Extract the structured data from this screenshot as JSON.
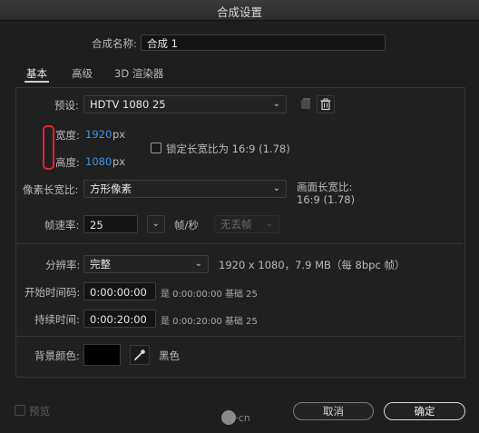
{
  "window": {
    "title": "合成设置"
  },
  "comp_name": {
    "label": "合成名称:",
    "value": "合成 1"
  },
  "tabs": [
    {
      "label": "基本"
    },
    {
      "label": "高级"
    },
    {
      "label": "3D 渲染器"
    }
  ],
  "preset": {
    "label": "预设:",
    "value": "HDTV 1080 25"
  },
  "width": {
    "label": "宽度:",
    "value": "1920",
    "unit": "px"
  },
  "height": {
    "label": "高度:",
    "value": "1080",
    "unit": "px"
  },
  "lock_aspect": {
    "label": "锁定长宽比为 16:9 (1.78)",
    "checked": false
  },
  "pixel_aspect": {
    "label": "像素长宽比:",
    "value": "方形像素"
  },
  "frame_aspect": {
    "label": "画面长宽比:",
    "value": "16:9 (1.78)"
  },
  "frame_rate": {
    "label": "帧速率:",
    "value": "25",
    "unit": "帧/秒",
    "dropframe": "无丢帧"
  },
  "resolution": {
    "label": "分辨率:",
    "value": "完整",
    "info": "1920 x 1080，7.9 MB（每 8bpc 帧）"
  },
  "start_timecode": {
    "label": "开始时间码:",
    "value": "0:00:00:00",
    "note": "是 0:00:00:00  基础 25"
  },
  "duration": {
    "label": "持续时间:",
    "value": "0:00:20:00",
    "note": "是 0:00:20:00  基础 25"
  },
  "background": {
    "label": "背景颜色:",
    "color": "#000000",
    "color_name": "黑色"
  },
  "footer": {
    "preview_label": "预览",
    "cancel_label": "取消",
    "ok_label": "确定",
    "watermark": "UI·cn"
  },
  "colors": {
    "accent_blue": "#3f95e6",
    "highlight_red": "#e0232f"
  }
}
